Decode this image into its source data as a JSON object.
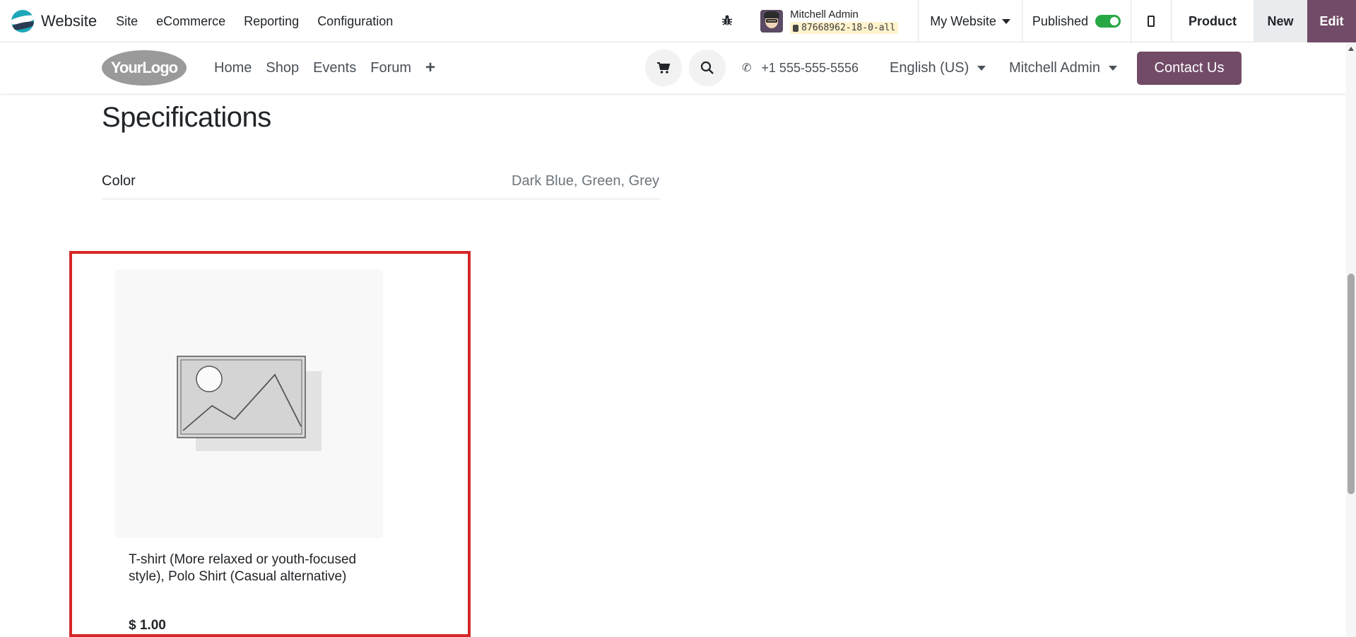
{
  "admin_bar": {
    "app_name": "Website",
    "menu": [
      "Site",
      "eCommerce",
      "Reporting",
      "Configuration"
    ],
    "user_name": "Mitchell Admin",
    "database": "87668962-18-0-all",
    "website_switcher": "My Website",
    "published_label": "Published",
    "published": true,
    "product_label": "Product",
    "new_label": "New",
    "edit_label": "Edit"
  },
  "site_header": {
    "logo_text": "YourLogo",
    "nav": [
      "Home",
      "Shop",
      "Events",
      "Forum"
    ],
    "phone": "+1 555-555-5556",
    "language": "English (US)",
    "account": "Mitchell Admin",
    "contact_label": "Contact Us"
  },
  "specifications": {
    "title": "Specifications",
    "rows": [
      {
        "label": "Color",
        "value": "Dark Blue, Green, Grey"
      }
    ]
  },
  "product_card": {
    "name": "T-shirt (More relaxed or youth-focused style), Polo Shirt (Casual alternative)",
    "price": "$ 1.00"
  },
  "colors": {
    "brand": "#714b67",
    "highlight": "#d62728",
    "published_toggle": "#28a745"
  }
}
